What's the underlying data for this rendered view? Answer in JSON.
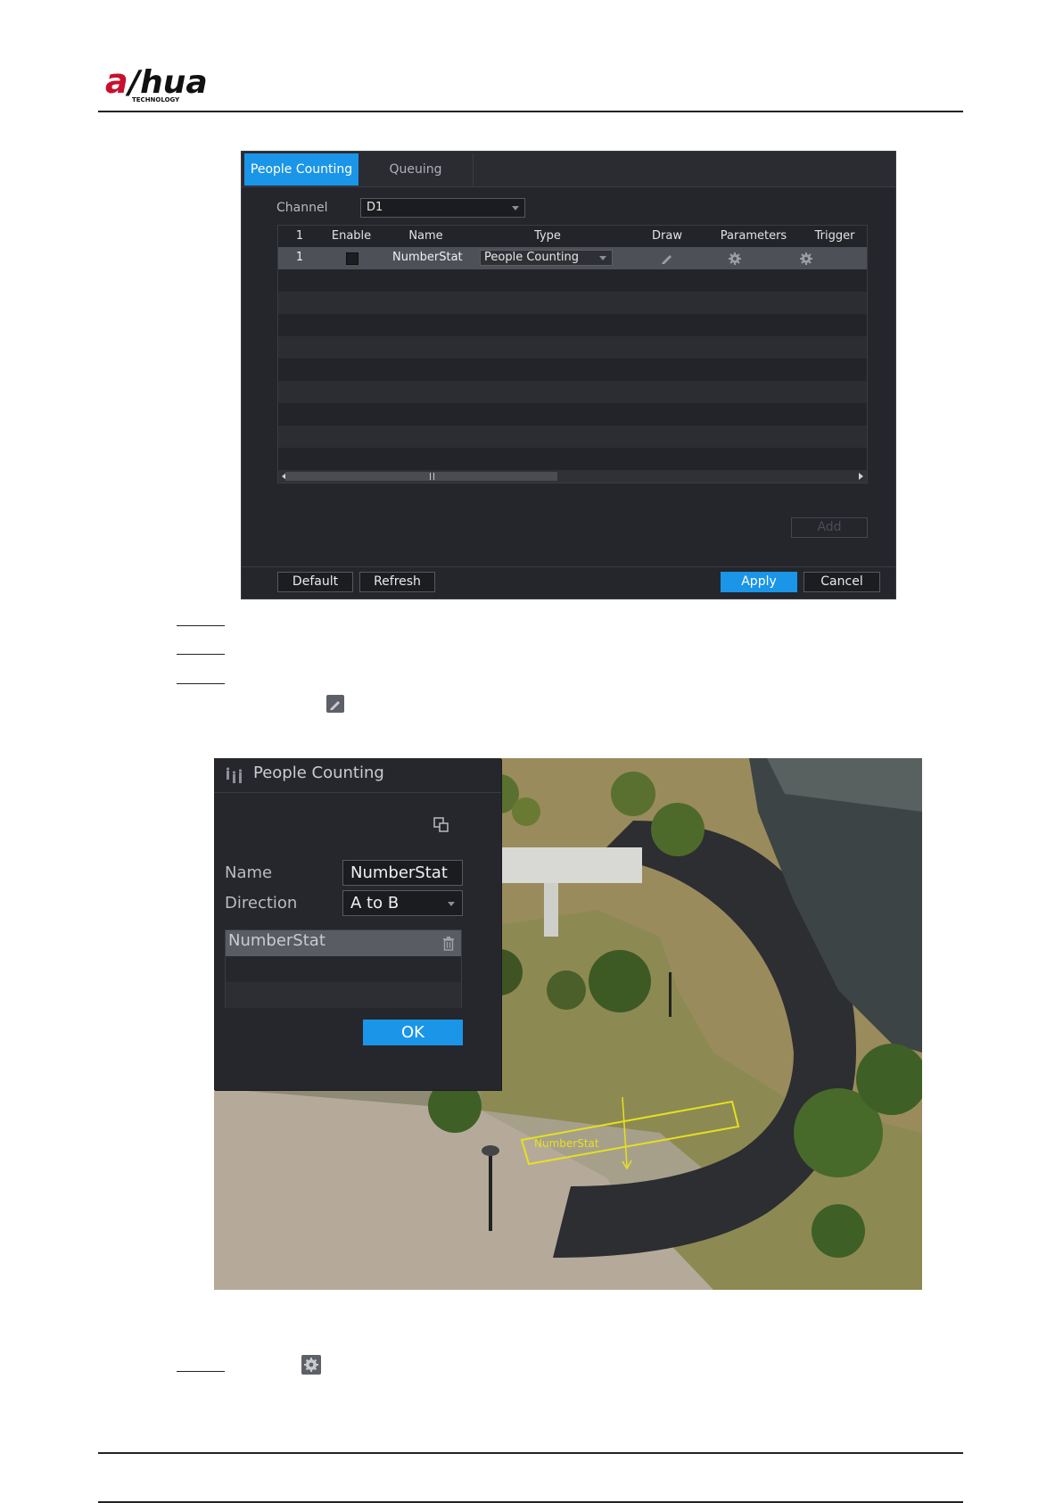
{
  "header": {
    "logo_text": "alhua",
    "logo_sub": "TECHNOLOGY"
  },
  "dialog1": {
    "tabs": [
      {
        "label": "People Counting",
        "active": true
      },
      {
        "label": "Queuing",
        "active": false
      }
    ],
    "channel_label": "Channel",
    "channel_value": "D1",
    "columns": [
      "1",
      "Enable",
      "Name",
      "Type",
      "Draw",
      "Parameters",
      "Trigger"
    ],
    "rows": [
      {
        "index": "1",
        "enabled": false,
        "name": "NumberStat",
        "type": "People Counting"
      }
    ],
    "add_label": "Add",
    "default_label": "Default",
    "refresh_label": "Refresh",
    "apply_label": "Apply",
    "cancel_label": "Cancel"
  },
  "steps": {
    "draw_icon": "pencil-icon",
    "params_icon": "gear-icon"
  },
  "dialog2": {
    "title": "People Counting",
    "title_icon": "people-counting-icon",
    "name_label": "Name",
    "name_value": "NumberStat",
    "direction_label": "Direction",
    "direction_value": "A to B",
    "rules": [
      {
        "name": "NumberStat"
      }
    ],
    "ok_label": "OK",
    "overlay_label": "NumberStat"
  },
  "colors": {
    "accent": "#1a95e8",
    "panel": "#25272c",
    "rule_line": "#e6e020"
  }
}
